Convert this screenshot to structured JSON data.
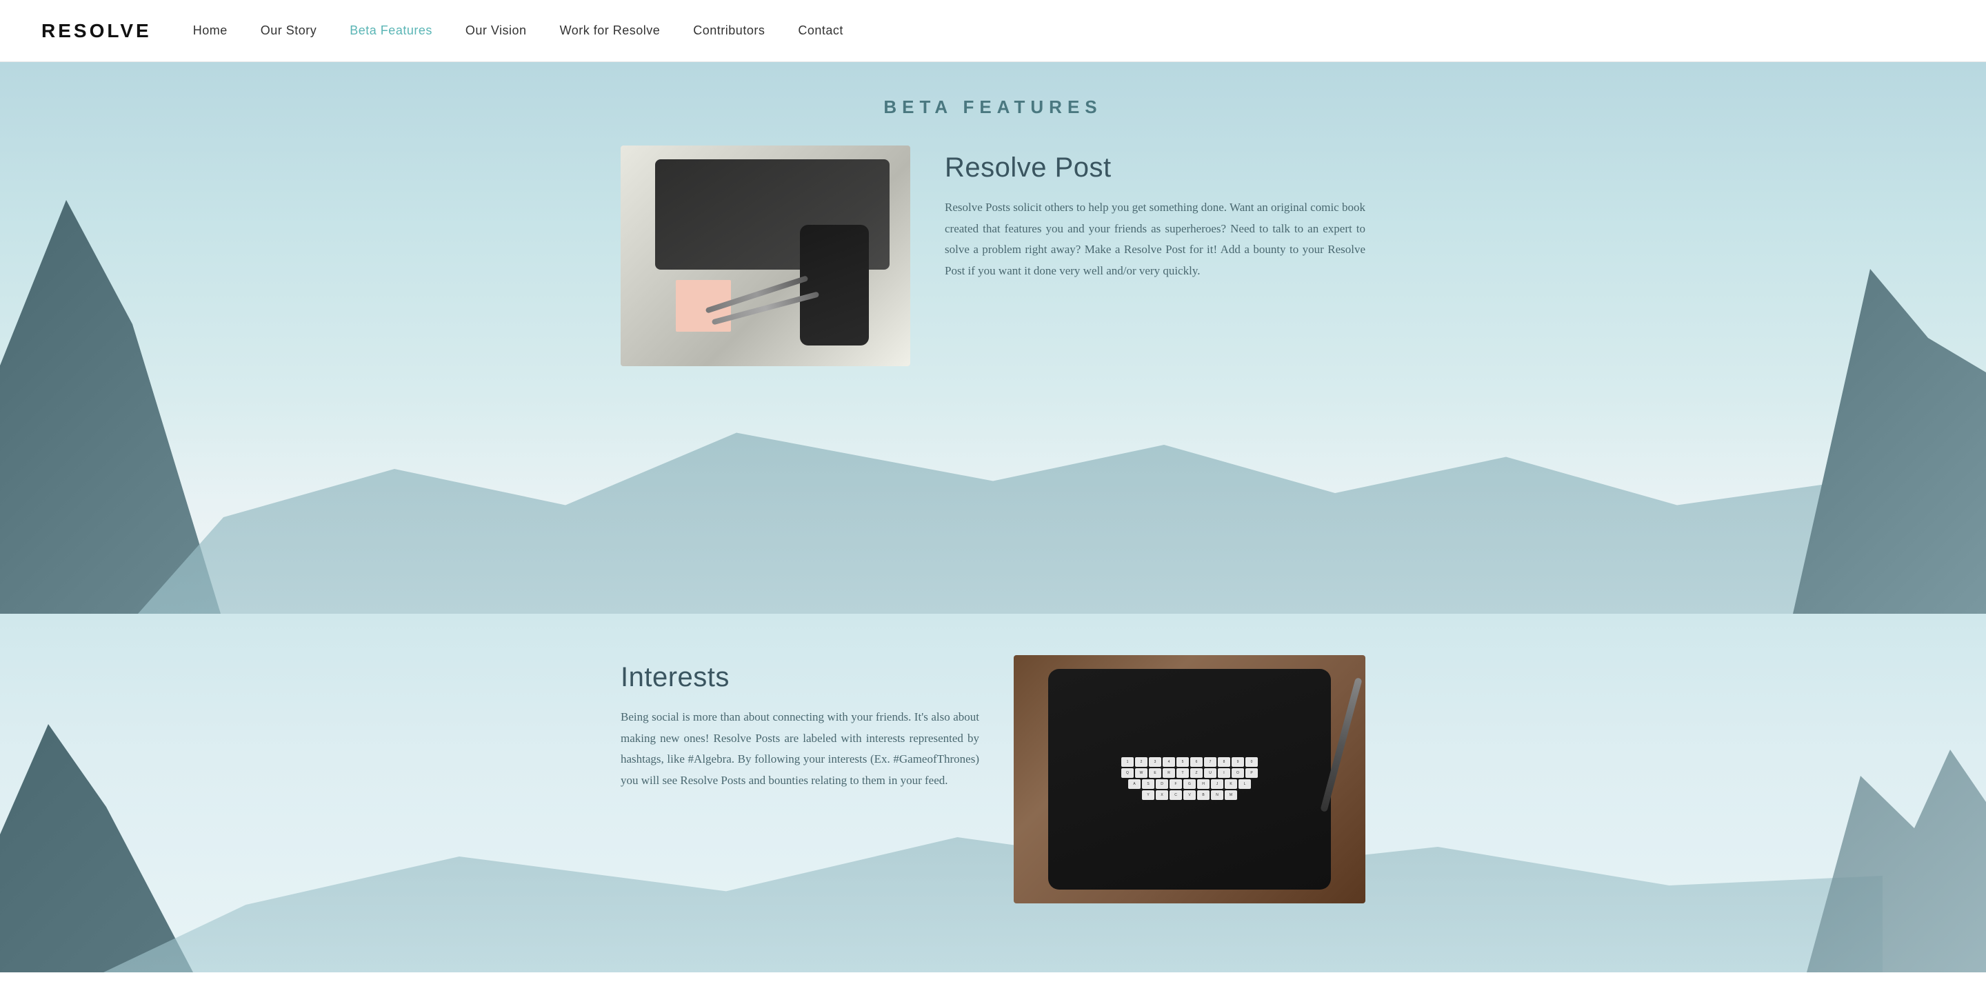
{
  "navbar": {
    "logo": "RESOLVE",
    "links": [
      {
        "id": "home",
        "label": "Home",
        "active": false
      },
      {
        "id": "our-story",
        "label": "Our Story",
        "active": false
      },
      {
        "id": "beta-features",
        "label": "Beta Features",
        "active": true
      },
      {
        "id": "our-vision",
        "label": "Our Vision",
        "active": false
      },
      {
        "id": "work-for-resolve",
        "label": "Work for Resolve",
        "active": false
      },
      {
        "id": "contributors",
        "label": "Contributors",
        "active": false
      },
      {
        "id": "contact",
        "label": "Contact",
        "active": false
      }
    ]
  },
  "page": {
    "section_title": "BETA FEATURES",
    "feature1": {
      "title": "Resolve Post",
      "description": "Resolve Posts solicit others to help you get something done. Want an original comic book created that features you and your friends as superheroes? Need to talk to an expert to solve a problem right away? Make a Resolve Post for it! Add a bounty to your Resolve Post if you want it done very well and/or very quickly."
    },
    "feature2": {
      "title": "Interests",
      "description": "Being social is more than about connecting with your friends. It's also about making new ones! Resolve Posts are labeled with interests represented by hashtags, like #Algebra. By following your interests (Ex. #GameofThrones) you will see Resolve Posts and bounties relating to them in your feed."
    }
  },
  "colors": {
    "accent": "#5ab5b5",
    "title_color": "#4a7880",
    "feature_title_color": "#3a5560",
    "text_color": "#4a6870",
    "nav_active": "#5ab5b5",
    "nav_default": "#333333"
  }
}
